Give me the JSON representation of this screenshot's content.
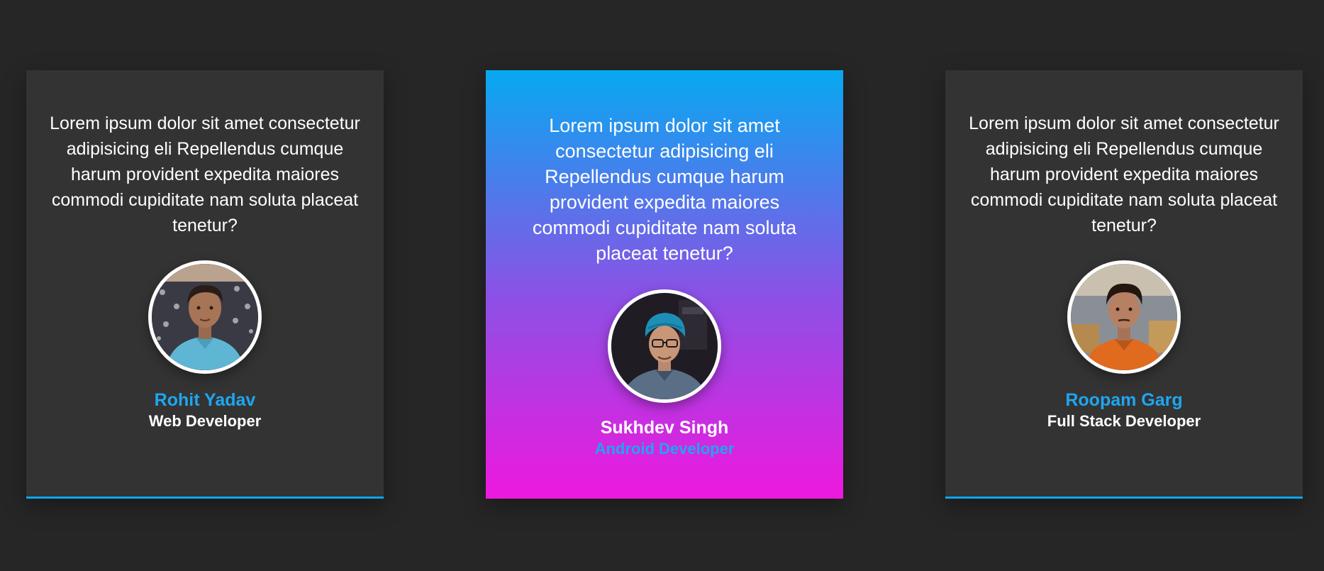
{
  "testimonials": [
    {
      "quote": "Lorem ipsum dolor sit amet consectetur adipisicing eli Repellendus cumque harum provident expedita maiores commodi cupiditate nam soluta placeat tenetur?",
      "name": "Rohit Yadav",
      "role": "Web Developer",
      "avatar": "photo-avatar"
    },
    {
      "quote": "Lorem ipsum dolor sit amet consectetur adipisicing eli Repellendus cumque harum provident expedita maiores commodi cupiditate nam soluta placeat tenetur?",
      "name": "Sukhdev Singh",
      "role": "Android Developer",
      "avatar": "photo-avatar"
    },
    {
      "quote": "Lorem ipsum dolor sit amet consectetur adipisicing eli Repellendus cumque harum provident expedita maiores commodi cupiditate nam soluta placeat tenetur?",
      "name": "Roopam Garg",
      "role": "Full Stack Developer",
      "avatar": "photo-avatar"
    }
  ],
  "colors": {
    "background": "#262626",
    "card": "#333333",
    "accent": "#0aa6f0",
    "gradient_top": "#07a9f1",
    "gradient_bottom": "#ee18de"
  }
}
